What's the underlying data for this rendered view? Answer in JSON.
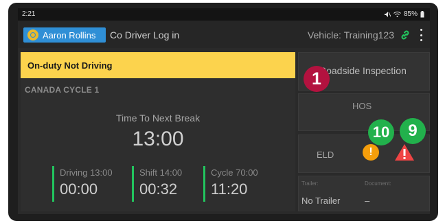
{
  "status_bar": {
    "time": "2:21",
    "battery": "85%"
  },
  "app_bar": {
    "driver_name": "Aaron Rollins",
    "co_driver_label": "Co Driver Log in",
    "vehicle_label": "Vehicle: Training123",
    "link_color": "#22c55e"
  },
  "duty": {
    "status": "On-duty Not Driving",
    "cycle": "CANADA CYCLE 1",
    "break_label": "Time To Next Break",
    "break_value": "13:00",
    "timers": [
      {
        "label": "Driving 13:00",
        "value": "00:00"
      },
      {
        "label": "Shift 14:00",
        "value": "00:32"
      },
      {
        "label": "Cycle 70:00",
        "value": "11:20"
      }
    ],
    "status_color": "#fcd34d"
  },
  "side": {
    "roadside_label": "Roadside Inspection",
    "hos_label": "HOS",
    "eld_label": "ELD",
    "eld_warning_symbol": "!",
    "trailer_label": "Trailer:",
    "trailer_value": "No Trailer",
    "document_label": "Document:",
    "document_value": "–"
  },
  "annotations": {
    "one": "1",
    "ten": "10",
    "nine": "9"
  }
}
